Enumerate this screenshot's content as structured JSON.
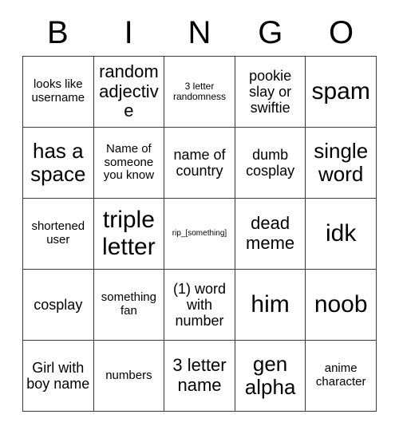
{
  "card": {
    "header_letters": [
      "B",
      "I",
      "N",
      "G",
      "O"
    ],
    "colors": {
      "background": "#ffffff",
      "text": "#000000",
      "border": "#3a3a3a"
    },
    "rows": [
      [
        {
          "text": "looks like username",
          "size": "fs-sm"
        },
        {
          "text": "random adjective",
          "size": "fs-lg"
        },
        {
          "text": "3 letter randomness",
          "size": "fs-xs"
        },
        {
          "text": "pookie slay or swiftie",
          "size": "fs-md"
        },
        {
          "text": "spam",
          "size": "fs-xxl"
        }
      ],
      [
        {
          "text": "has a space",
          "size": "fs-xl"
        },
        {
          "text": "Name of someone you know",
          "size": "fs-sm"
        },
        {
          "text": "name of country",
          "size": "fs-md"
        },
        {
          "text": "dumb cosplay",
          "size": "fs-md"
        },
        {
          "text": "single word",
          "size": "fs-xl"
        }
      ],
      [
        {
          "text": "shortened user",
          "size": "fs-sm"
        },
        {
          "text": "triple letter",
          "size": "fs-xxl"
        },
        {
          "text": "rip_[something]",
          "size": "fs-xxs"
        },
        {
          "text": "dead meme",
          "size": "fs-lg"
        },
        {
          "text": "idk",
          "size": "fs-xxl"
        }
      ],
      [
        {
          "text": "cosplay",
          "size": "fs-md"
        },
        {
          "text": "something fan",
          "size": "fs-sm"
        },
        {
          "text": "(1) word with number",
          "size": "fs-md"
        },
        {
          "text": "him",
          "size": "fs-xxl"
        },
        {
          "text": "noob",
          "size": "fs-xxl"
        }
      ],
      [
        {
          "text": "Girl with boy name",
          "size": "fs-md"
        },
        {
          "text": "numbers",
          "size": "fs-sm"
        },
        {
          "text": "3 letter name",
          "size": "fs-lg"
        },
        {
          "text": "gen alpha",
          "size": "fs-xl"
        },
        {
          "text": "anime character",
          "size": "fs-sm"
        }
      ]
    ]
  }
}
